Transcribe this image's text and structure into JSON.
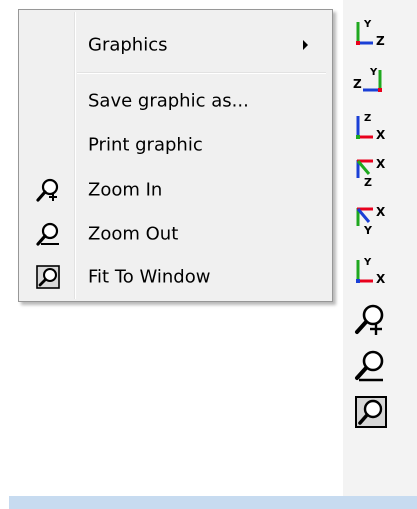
{
  "context_menu": {
    "items": [
      {
        "label": "Graphics",
        "has_submenu": true,
        "icon": null
      },
      {
        "label": "Save graphic as...",
        "icon": null
      },
      {
        "label": "Print graphic",
        "icon": null
      },
      {
        "label": "Zoom In",
        "icon": "zoom-in-icon"
      },
      {
        "label": "Zoom Out",
        "icon": "zoom-out-icon"
      },
      {
        "label": "Fit To Window",
        "icon": "fit-to-window-icon"
      }
    ]
  },
  "toolbar": {
    "tools": [
      {
        "name": "view-yz-icon",
        "axis_labels": [
          "Y",
          "Z"
        ]
      },
      {
        "name": "view-zy-icon",
        "axis_labels": [
          "Z",
          "Y"
        ]
      },
      {
        "name": "view-zx-icon",
        "axis_labels": [
          "Z",
          "X"
        ]
      },
      {
        "name": "view-iso-zx-icon",
        "axis_labels": [
          "Z",
          "X"
        ]
      },
      {
        "name": "view-iso-yx-icon",
        "axis_labels": [
          "Y",
          "X"
        ]
      },
      {
        "name": "view-yx-icon",
        "axis_labels": [
          "Y",
          "X"
        ]
      },
      {
        "name": "zoom-in-icon"
      },
      {
        "name": "zoom-out-icon"
      },
      {
        "name": "fit-to-window-icon"
      }
    ]
  },
  "colors": {
    "menu_background": "#f0f0f0",
    "menu_border": "#979797",
    "toolbar_background": "#f3f3f3",
    "bottom_bar": "#c7dbf0",
    "axis_red": "#e8001c",
    "axis_green": "#1fa81f",
    "axis_blue": "#1a3fd6"
  }
}
